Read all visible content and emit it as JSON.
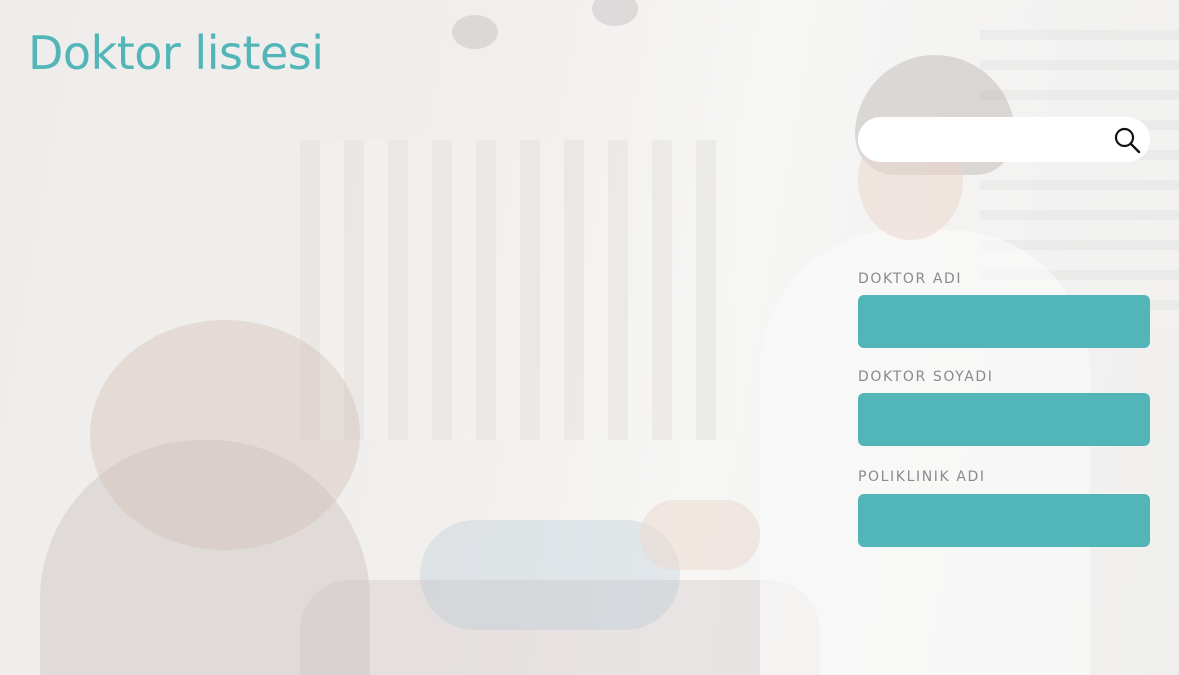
{
  "page": {
    "title": "Doktor listesi"
  },
  "search": {
    "value": "",
    "placeholder": "",
    "icon": "search-icon"
  },
  "form": {
    "fields": [
      {
        "label": "DOKTOR ADI",
        "value": ""
      },
      {
        "label": "DOKTOR SOYADI",
        "value": ""
      },
      {
        "label": "POLIKLINIK ADI",
        "value": ""
      }
    ]
  },
  "colors": {
    "accent": "#52b6b8",
    "label": "#8b8a8a",
    "search_background": "#ffffff"
  }
}
